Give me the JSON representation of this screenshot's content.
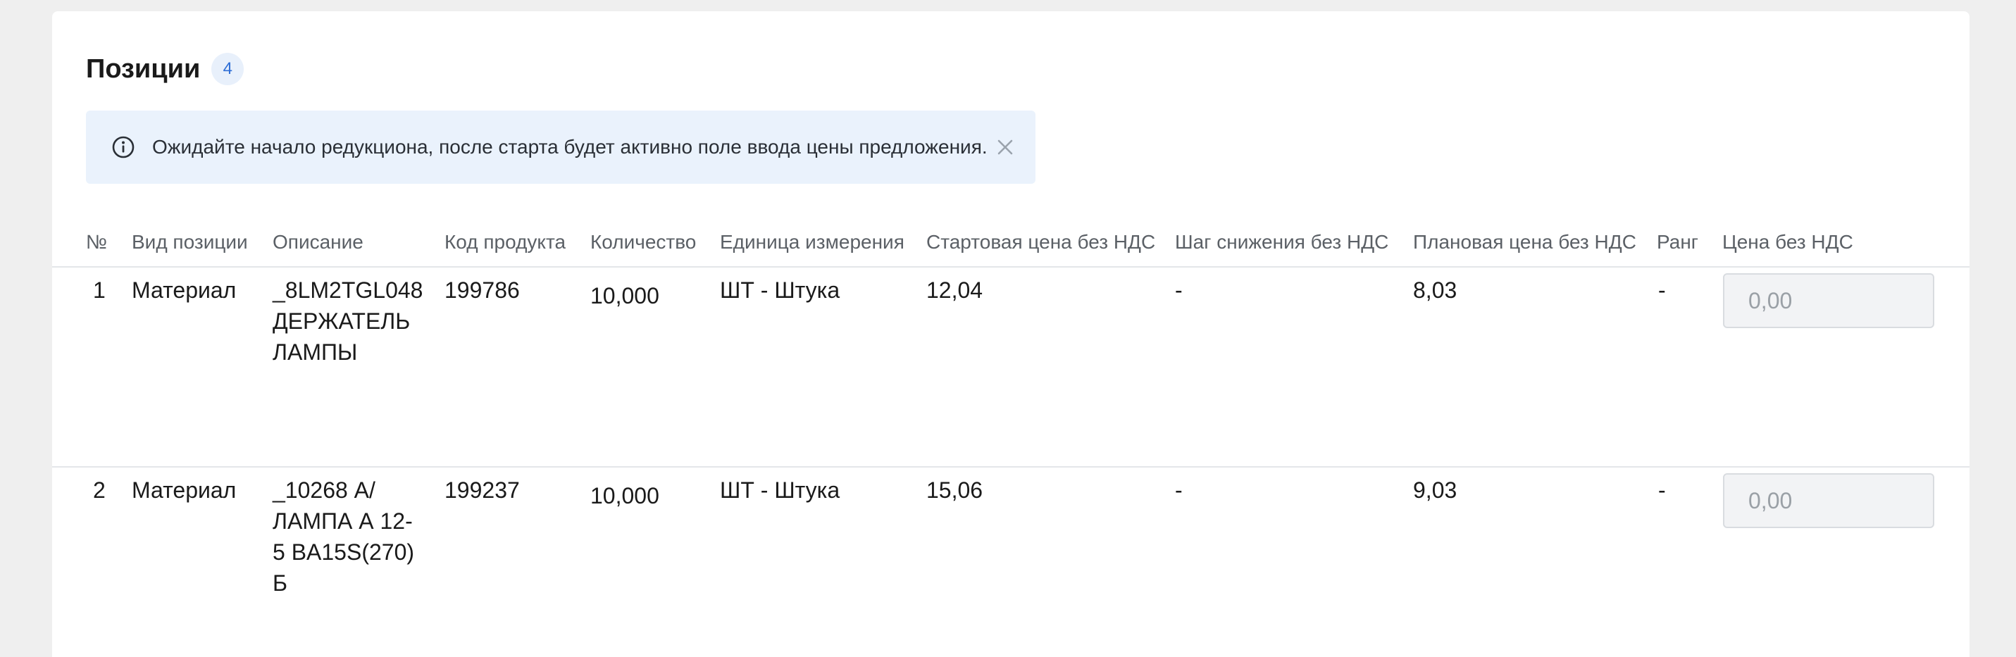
{
  "section": {
    "title": "Позиции",
    "count": "4"
  },
  "banner": {
    "icon": "info-circle-icon",
    "text": "Ожидайте начало редукциона, после старта будет активно поле ввода цены предложения.",
    "close_icon": "close-icon"
  },
  "table": {
    "columns": [
      "№",
      "Вид позиции",
      "Описание",
      "Код продукта",
      "Количество",
      "Единица измерения",
      "Стартовая цена без НДС",
      "Шаг снижения без НДС",
      "Плановая цена без НДС",
      "Ранг",
      "Цена без НДС"
    ],
    "rows": [
      {
        "num": "1",
        "type": "Материал",
        "description": "_8LM2TGL048 ДЕРЖАТЕЛЬ ЛАМПЫ",
        "product_code": "199786",
        "quantity": "10,000",
        "unit": "ШТ - Штука",
        "start_price": "12,04",
        "step": "-",
        "planned_price": "8,03",
        "rank": "-",
        "price_placeholder": "0,00"
      },
      {
        "num": "2",
        "type": "Материал",
        "description": "_10268 А/ЛАМПА А 12-5 BA15S(270) Б",
        "product_code": "199237",
        "quantity": "10,000",
        "unit": "ШТ - Штука",
        "start_price": "15,06",
        "step": "-",
        "planned_price": "9,03",
        "rank": "-",
        "price_placeholder": "0,00"
      }
    ]
  },
  "colors": {
    "banner_bg": "#eaf2fc",
    "badge_text": "#2f6fd6",
    "header_text": "#5b6066"
  }
}
